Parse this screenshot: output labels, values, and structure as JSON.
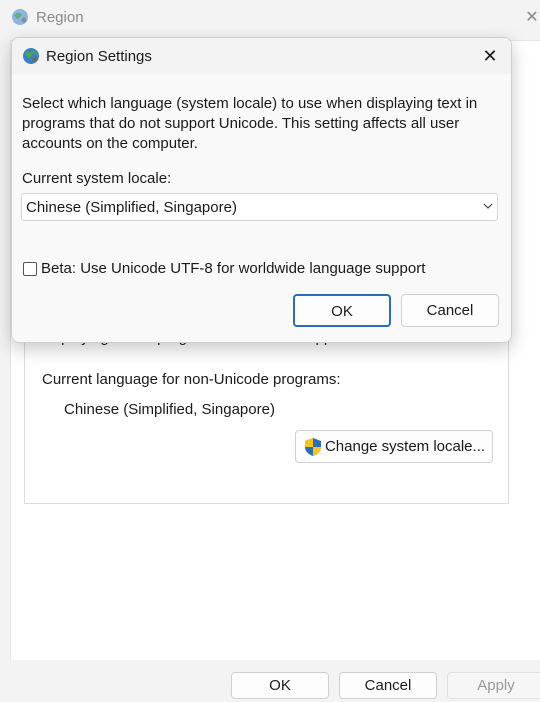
{
  "background_window": {
    "title": "Region",
    "cutoff_text": "displaying text in programs that do not support Unicode.",
    "non_unicode_label": "Current language for non-Unicode programs:",
    "non_unicode_value": "Chinese (Simplified, Singapore)",
    "change_locale_button": "Change system locale...",
    "footer": {
      "ok": "OK",
      "cancel": "Cancel",
      "apply": "Apply"
    }
  },
  "dialog": {
    "title": "Region Settings",
    "close_glyph": "✕",
    "description": "Select which language (system locale) to use when displaying text in programs that do not support Unicode. This setting affects all user accounts on the computer.",
    "locale_label": "Current system locale:",
    "locale_selected": "Chinese (Simplified, Singapore)",
    "beta_checkbox_label": "Beta: Use Unicode UTF-8 for worldwide language support",
    "beta_checked": false,
    "ok_label": "OK",
    "cancel_label": "Cancel"
  },
  "icons": {
    "window_icon": "globe-region-icon",
    "shield_icon": "uac-shield-icon",
    "chevron": "chevron-down-icon"
  },
  "colors": {
    "accent": "#0f7b6c",
    "ok_border": "#2a6fb5"
  }
}
